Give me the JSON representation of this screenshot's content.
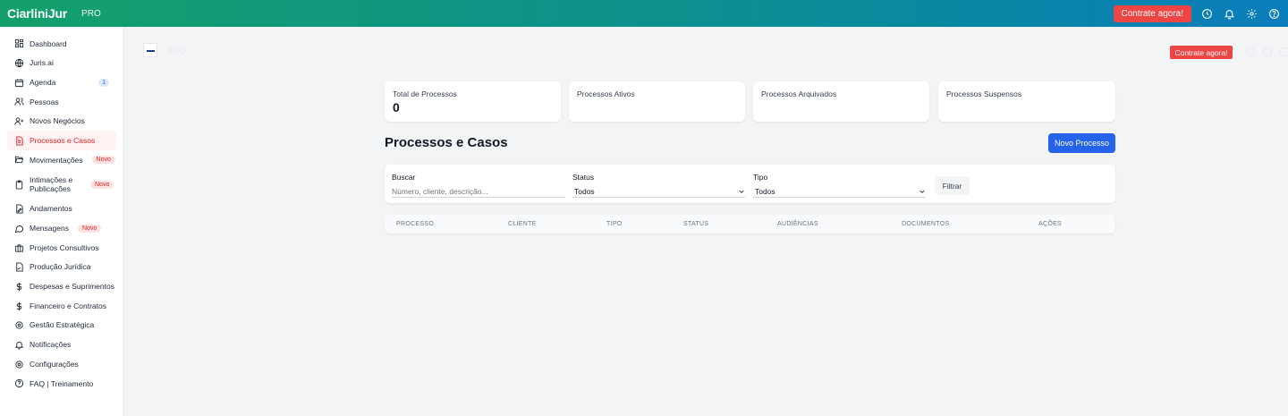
{
  "topbar": {
    "brand": "CiarliniJur",
    "plan": "PRO",
    "cta_label": "Contrate agora!",
    "icons": [
      "clock-icon",
      "bell-icon",
      "gear-icon",
      "help-icon"
    ]
  },
  "sidebar": {
    "items": [
      {
        "label": "Dashboard",
        "icon": "dashboard-icon"
      },
      {
        "label": "Juris.ai",
        "icon": "globe-icon"
      },
      {
        "label": "Agenda",
        "icon": "calendar-icon",
        "count": "1"
      },
      {
        "label": "Pessoas",
        "icon": "users-icon"
      },
      {
        "label": "Novos Negócios",
        "icon": "user-plus-icon"
      },
      {
        "label": "Processos e Casos",
        "icon": "document-icon",
        "active": true
      },
      {
        "label": "Movimentações",
        "icon": "folder-open-icon",
        "badge": "Novo"
      },
      {
        "label": "Intimações e Publicações",
        "icon": "clipboard-icon",
        "badge": "Novo"
      },
      {
        "label": "Andamentos",
        "icon": "file-edit-icon"
      },
      {
        "label": "Mensagens",
        "icon": "message-icon",
        "badge": "Novo"
      },
      {
        "label": "Projetos Consultivos",
        "icon": "briefcase-icon"
      },
      {
        "label": "Produção Jurídica",
        "icon": "file-signature-icon"
      },
      {
        "label": "Despesas e Suprimentos",
        "icon": "dollar-icon"
      },
      {
        "label": "Financeiro e Contratos",
        "icon": "dollar-icon"
      },
      {
        "label": "Gestão Estratégica",
        "icon": "gear-icon"
      },
      {
        "label": "Notificações",
        "icon": "bell-icon"
      },
      {
        "label": "Configurações",
        "icon": "gear-icon"
      },
      {
        "label": "FAQ | Treinamento",
        "icon": "help-icon"
      }
    ]
  },
  "ghost_header": {
    "plan": "PRO",
    "cta_label": "Contrate agora!"
  },
  "stats": [
    {
      "label": "Total de Processos",
      "value": "0"
    },
    {
      "label": "Processos Ativos",
      "value": ""
    },
    {
      "label": "Processos Arquivados",
      "value": ""
    },
    {
      "label": "Processos Suspensos",
      "value": ""
    }
  ],
  "main": {
    "title": "Processos e Casos",
    "new_button": "Novo Processo"
  },
  "filters": {
    "search_label": "Buscar",
    "search_placeholder": "Número, cliente, descrição...",
    "status_label": "Status",
    "status_value": "Todos",
    "tipo_label": "Tipo",
    "tipo_value": "Todos",
    "filter_button": "Filtrar"
  },
  "table": {
    "columns": [
      "PROCESSO",
      "CLIENTE",
      "TIPO",
      "STATUS",
      "AUDIÊNCIAS",
      "DOCUMENTOS",
      "AÇÕES"
    ]
  },
  "colors": {
    "accent_red": "#ef4444",
    "primary_blue": "#2563eb",
    "gradient_start": "#13a06a",
    "gradient_end": "#0a7dbb"
  }
}
